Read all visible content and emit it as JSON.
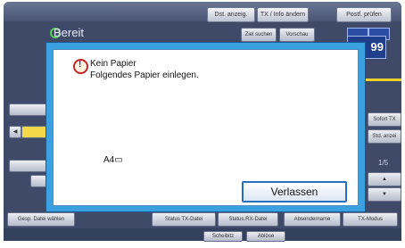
{
  "top_buttons": [
    "Dst. anzeig.",
    "TX / Info ändern",
    "Postf. prüfen"
  ],
  "status": "Bereit",
  "toolbar2": [
    "Ziel suchen",
    "Vorschau"
  ],
  "counter": "99",
  "right_buttons": [
    "Sofort TX",
    "Std. anzei"
  ],
  "page_ind": "1/5",
  "bottom_buttons": [
    "Gesp. Datei wählen",
    "Status TX-Datei",
    "Status.RX-Datei",
    "Absendername",
    "TX-Modus"
  ],
  "footer_buttons": [
    "Scheibitz",
    "Ablöse"
  ],
  "dialog": {
    "line1": "Kein Papier",
    "line2": "Folgendes Papier einlegen.",
    "paper": "A4▭",
    "button": "Verlassen"
  }
}
